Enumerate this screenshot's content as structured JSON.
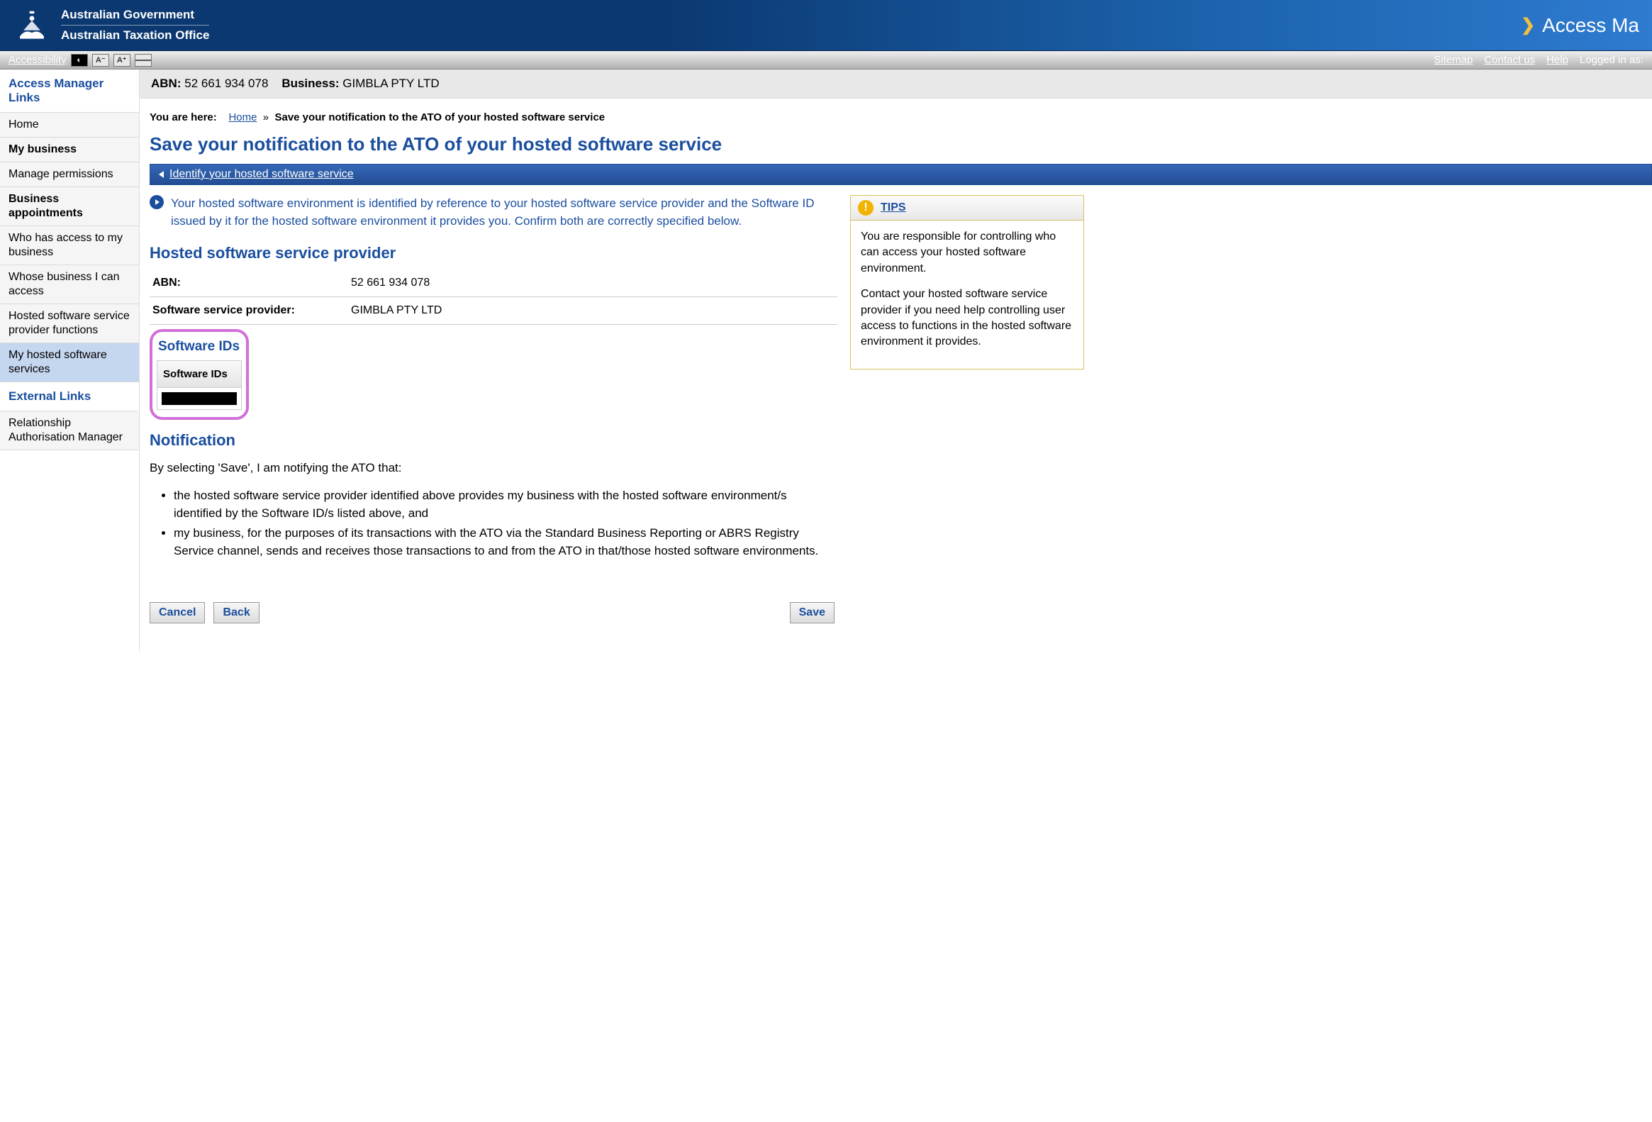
{
  "header": {
    "gov_line1": "Australian Government",
    "gov_line2": "Australian Taxation Office",
    "brand": "Access Ma"
  },
  "toolbar": {
    "accessibility": "Accessibility",
    "sitemap": "Sitemap",
    "contact": "Contact us",
    "help": "Help",
    "logged": "Logged in as:"
  },
  "sidebar": {
    "heading1": "Access Manager Links",
    "items": [
      {
        "label": "Home",
        "bold": false
      },
      {
        "label": "My business",
        "bold": true
      },
      {
        "label": "Manage permissions",
        "bold": false
      },
      {
        "label": "Business appointments",
        "bold": true
      },
      {
        "label": "Who has access to my business",
        "bold": false
      },
      {
        "label": "Whose business I can access",
        "bold": false
      },
      {
        "label": "Hosted software service provider functions",
        "bold": false
      },
      {
        "label": "My hosted software services",
        "bold": false,
        "active": true
      }
    ],
    "heading2": "External Links",
    "external": [
      {
        "label": "Relationship Authorisation Manager"
      }
    ]
  },
  "abnbar": {
    "abn_label": "ABN:",
    "abn_value": "52 661 934 078",
    "business_label": "Business:",
    "business_value": "GIMBLA PTY LTD"
  },
  "crumbs": {
    "here": "You are here:",
    "home": "Home",
    "sep": "»",
    "current": "Save your notification to the ATO of your hosted software service"
  },
  "page_title": "Save your notification to the ATO of your hosted software service",
  "bluebar": {
    "label": "Identify your hosted software service"
  },
  "info": "Your hosted software environment is identified by reference to your hosted software service provider and the Software ID issued by it for the hosted software environment it provides you. Confirm both are correctly specified below.",
  "provider": {
    "heading": "Hosted software service provider",
    "abn_label": "ABN:",
    "abn_value": "52 661 934 078",
    "name_label": "Software service provider:",
    "name_value": "GIMBLA PTY LTD"
  },
  "swids": {
    "heading": "Software IDs",
    "col": "Software IDs"
  },
  "notification": {
    "heading": "Notification",
    "intro": "By selecting 'Save', I am notifying the ATO that:",
    "bullets": [
      "the hosted software service provider identified above provides my business with the hosted software environment/s identified by the Software ID/s listed above, and",
      "my business, for the purposes of its transactions with the ATO via the Standard Business Reporting or ABRS Registry Service channel, sends and receives those transactions to and from the ATO in that/those hosted software environments."
    ]
  },
  "buttons": {
    "cancel": "Cancel",
    "back": "Back",
    "save": "Save"
  },
  "tips": {
    "heading": "TIPS",
    "p1": "You are responsible for controlling who can access your hosted software environment.",
    "p2": "Contact your hosted software service provider if you need help controlling user access to functions in the hosted software environment it provides."
  }
}
